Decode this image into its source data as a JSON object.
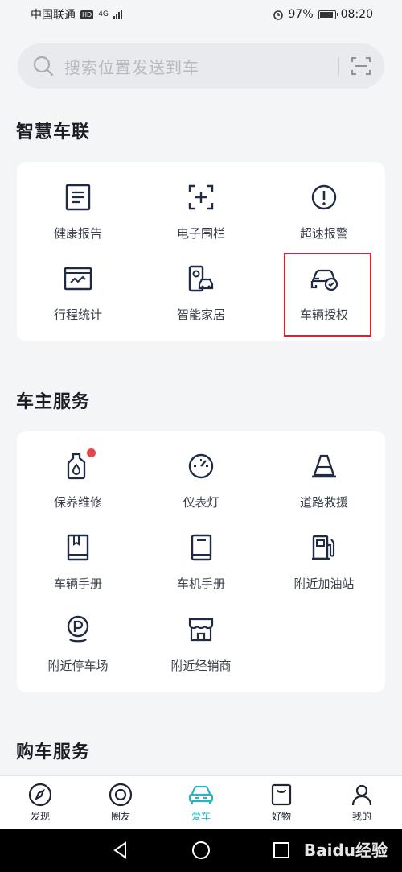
{
  "status_bar": {
    "carrier": "中国联通",
    "hd_badge": "HD",
    "network": "4G",
    "battery_percent": "97%",
    "battery_level": 0.97,
    "time": "08:20"
  },
  "search": {
    "placeholder": "搜索位置发送到车"
  },
  "sections": {
    "smart": {
      "title": "智慧车联",
      "items": [
        {
          "label": "健康报告",
          "icon": "report-icon"
        },
        {
          "label": "电子围栏",
          "icon": "geofence-icon"
        },
        {
          "label": "超速报警",
          "icon": "alert-icon"
        },
        {
          "label": "行程统计",
          "icon": "trip-stats-icon"
        },
        {
          "label": "智能家居",
          "icon": "smart-home-icon"
        },
        {
          "label": "车辆授权",
          "icon": "car-auth-icon"
        }
      ]
    },
    "owner": {
      "title": "车主服务",
      "items": [
        {
          "label": "保养维修",
          "icon": "oil-icon"
        },
        {
          "label": "仪表灯",
          "icon": "gauge-icon"
        },
        {
          "label": "道路救援",
          "icon": "cone-icon"
        },
        {
          "label": "车辆手册",
          "icon": "book-icon"
        },
        {
          "label": "车机手册",
          "icon": "manual-icon"
        },
        {
          "label": "附近加油站",
          "icon": "fuel-icon"
        },
        {
          "label": "附近停车场",
          "icon": "parking-icon"
        },
        {
          "label": "附近经销商",
          "icon": "dealer-icon"
        }
      ]
    },
    "purchase": {
      "title": "购车服务"
    }
  },
  "tabs": [
    {
      "label": "发现",
      "icon": "compass-icon"
    },
    {
      "label": "圈友",
      "icon": "circle-icon"
    },
    {
      "label": "爱车",
      "icon": "car-icon",
      "active": true
    },
    {
      "label": "好物",
      "icon": "shop-icon"
    },
    {
      "label": "我的",
      "icon": "user-icon"
    }
  ],
  "watermark": "Baidu经验",
  "colors": {
    "accent": "#2bb3c0",
    "icon": "#1f2a44",
    "highlight": "#d8222b",
    "dot": "#e8474a"
  }
}
